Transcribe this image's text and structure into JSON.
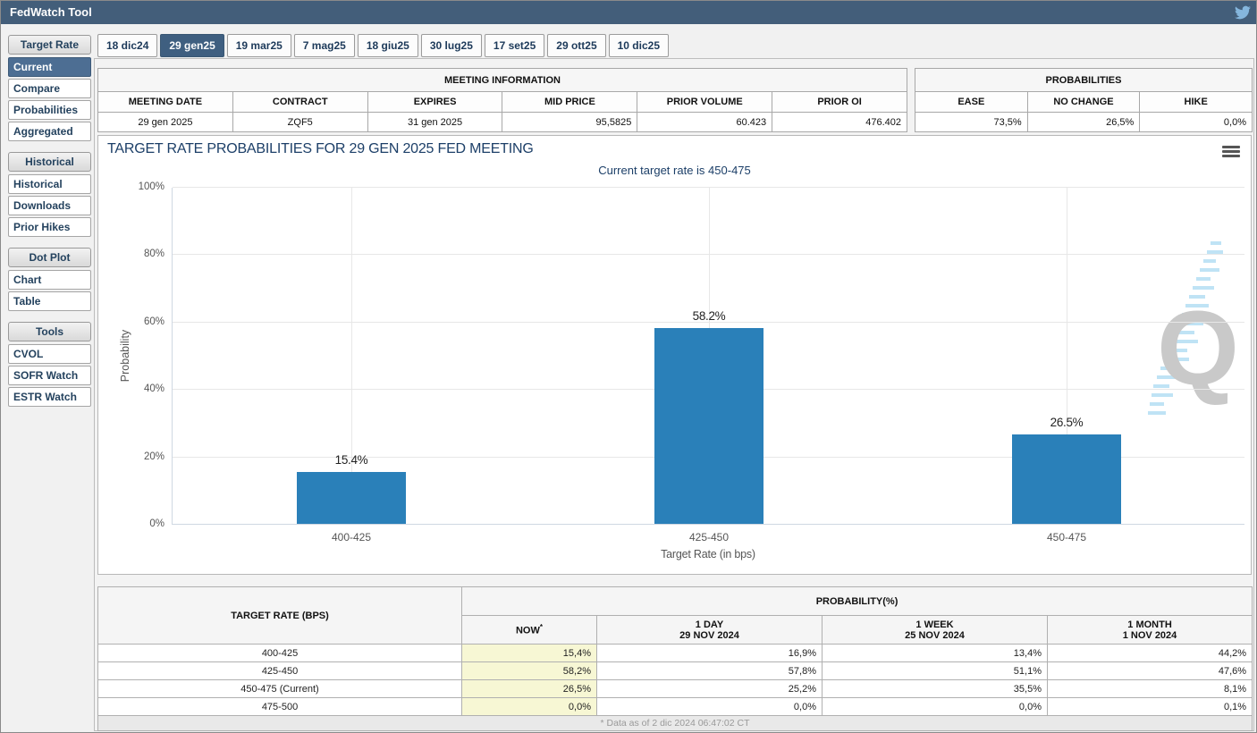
{
  "header": {
    "title": "FedWatch Tool"
  },
  "tabs": [
    {
      "label": "18 dic24",
      "selected": false
    },
    {
      "label": "29 gen25",
      "selected": true
    },
    {
      "label": "19 mar25",
      "selected": false
    },
    {
      "label": "7 mag25",
      "selected": false
    },
    {
      "label": "18 giu25",
      "selected": false
    },
    {
      "label": "30 lug25",
      "selected": false
    },
    {
      "label": "17 set25",
      "selected": false
    },
    {
      "label": "29 ott25",
      "selected": false
    },
    {
      "label": "10 dic25",
      "selected": false
    }
  ],
  "sidebar": {
    "sections": [
      {
        "header": "Target Rate",
        "items": [
          {
            "label": "Current",
            "selected": true
          },
          {
            "label": "Compare",
            "selected": false
          },
          {
            "label": "Probabilities",
            "selected": false
          },
          {
            "label": "Aggregated",
            "selected": false
          }
        ]
      },
      {
        "header": "Historical",
        "items": [
          {
            "label": "Historical",
            "selected": false
          },
          {
            "label": "Downloads",
            "selected": false
          },
          {
            "label": "Prior Hikes",
            "selected": false
          }
        ]
      },
      {
        "header": "Dot Plot",
        "items": [
          {
            "label": "Chart",
            "selected": false
          },
          {
            "label": "Table",
            "selected": false
          }
        ]
      },
      {
        "header": "Tools",
        "items": [
          {
            "label": "CVOL",
            "selected": false
          },
          {
            "label": "SOFR Watch",
            "selected": false
          },
          {
            "label": "ESTR Watch",
            "selected": false
          }
        ]
      }
    ]
  },
  "meeting_information": {
    "title": "MEETING INFORMATION",
    "columns": [
      "MEETING DATE",
      "CONTRACT",
      "EXPIRES",
      "MID PRICE",
      "PRIOR VOLUME",
      "PRIOR OI"
    ],
    "values": [
      "29 gen 2025",
      "ZQF5",
      "31 gen 2025",
      "95,5825",
      "60.423",
      "476.402"
    ]
  },
  "probabilities_summary": {
    "title": "PROBABILITIES",
    "columns": [
      "EASE",
      "NO CHANGE",
      "HIKE"
    ],
    "values": [
      "73,5%",
      "26,5%",
      "0,0%"
    ]
  },
  "chart_data": {
    "type": "bar",
    "title": "TARGET RATE PROBABILITIES FOR 29 GEN 2025 FED MEETING",
    "subtitle": "Current target rate is 450-475",
    "categories": [
      "400-425",
      "425-450",
      "450-475"
    ],
    "values": [
      15.4,
      58.2,
      26.5
    ],
    "value_labels": [
      "15.4%",
      "58.2%",
      "26.5%"
    ],
    "xlabel": "Target Rate (in bps)",
    "ylabel": "Probability",
    "ylim": [
      0,
      100
    ],
    "yticks": [
      "0%",
      "20%",
      "40%",
      "60%",
      "80%",
      "100%"
    ],
    "grid": true,
    "legend": "none",
    "watermark": "Q"
  },
  "probability_table": {
    "col1_header": "TARGET RATE (BPS)",
    "group_header": "PROBABILITY(%)",
    "sub_headers": [
      {
        "label": "NOW",
        "sup": "*"
      },
      {
        "label": "1 DAY",
        "line2": "29 NOV 2024"
      },
      {
        "label": "1 WEEK",
        "line2": "25 NOV 2024"
      },
      {
        "label": "1 MONTH",
        "line2": "1 NOV 2024"
      }
    ],
    "rows": [
      {
        "rate": "400-425",
        "now": "15,4%",
        "day": "16,9%",
        "week": "13,4%",
        "month": "44,2%"
      },
      {
        "rate": "425-450",
        "now": "58,2%",
        "day": "57,8%",
        "week": "51,1%",
        "month": "47,6%"
      },
      {
        "rate": "450-475 (Current)",
        "now": "26,5%",
        "day": "25,2%",
        "week": "35,5%",
        "month": "8,1%"
      },
      {
        "rate": "475-500",
        "now": "0,0%",
        "day": "0,0%",
        "week": "0,0%",
        "month": "0,1%"
      }
    ],
    "footnote": "* Data as of 2 dic 2024 06:47:02 CT"
  },
  "colors": {
    "header_bar": "#435e7a",
    "selected": "#3f5f80",
    "sidebar_selected": "#4d6e93",
    "bar": "#2a80b9",
    "now_highlight": "#f7f7d4",
    "navy": "#1c3f68",
    "twitter": "#85b6dd"
  }
}
